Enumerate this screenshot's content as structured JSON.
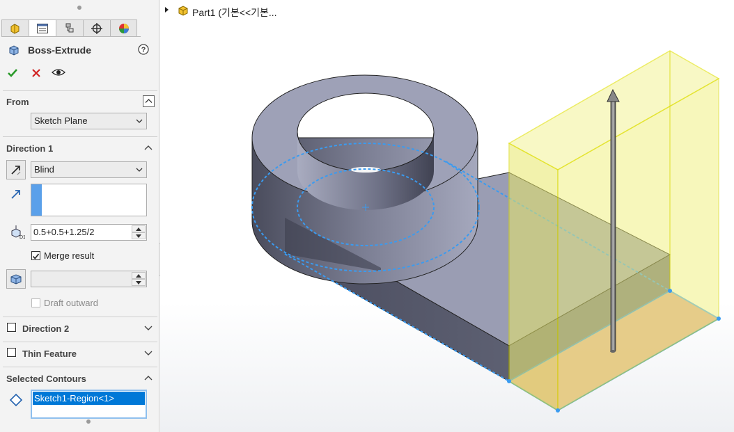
{
  "feature": {
    "title": "Boss-Extrude",
    "help_icon": "help-icon",
    "ok_icon": "checkmark-icon",
    "cancel_icon": "x-icon",
    "preview_icon": "eye-icon"
  },
  "tabs": [
    {
      "icon": "feature-manager-icon"
    },
    {
      "icon": "property-manager-icon"
    },
    {
      "icon": "configuration-manager-icon"
    },
    {
      "icon": "dimxpert-manager-icon"
    },
    {
      "icon": "display-manager-icon"
    }
  ],
  "from": {
    "title": "From",
    "selected": "Sketch Plane"
  },
  "direction1": {
    "title": "Direction 1",
    "end_condition": "Blind",
    "depth": "0.5+0.5+1.25/2",
    "merge_label": "Merge result",
    "merge_checked": true,
    "draft_label": "Draft outward",
    "draft_value": ""
  },
  "direction2": {
    "title": "Direction 2"
  },
  "thin_feature": {
    "title": "Thin Feature"
  },
  "contours": {
    "title": "Selected Contours",
    "items": [
      "Sketch1-Region<1>"
    ]
  },
  "tree": {
    "label": "Part1 (기본<<기본..."
  },
  "colors": {
    "accent": "#3399ff",
    "selection": "#0078d7",
    "preview_yellow": "#f3f36a",
    "part_gray": "#9ca0b4"
  }
}
